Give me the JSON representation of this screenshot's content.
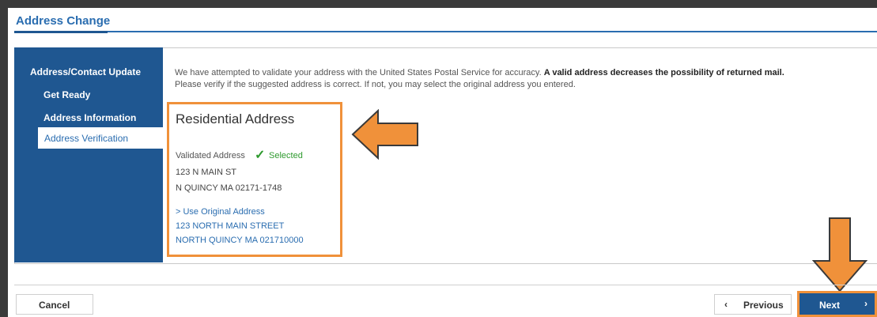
{
  "page": {
    "title": "Address Change"
  },
  "sidebar": {
    "heading": "Address/Contact Update",
    "items": [
      {
        "label": "Get Ready"
      },
      {
        "label": "Address Information"
      },
      {
        "label": "Address Verification",
        "active": true
      }
    ]
  },
  "intro": {
    "text": "We have attempted to validate your address with the United States Postal Service for accuracy.",
    "bold_text": "A valid address decreases the possibility of returned mail.",
    "line2": "Please verify if the suggested address is correct.  If not, you may select the original address you entered."
  },
  "address": {
    "title": "Residential Address",
    "validated_label": "Validated Address",
    "selected_label": "Selected",
    "validated_lines": [
      "123 N MAIN ST",
      "N QUINCY MA 02171-1748"
    ],
    "original_link": "> Use Original Address",
    "original_lines": [
      "123 NORTH MAIN STREET",
      "NORTH QUINCY MA 021710000"
    ]
  },
  "footer": {
    "cancel": "Cancel",
    "previous": "Previous",
    "next": "Next"
  },
  "icons": {
    "check": "check-icon",
    "chevron_left": "chevron-left-icon",
    "chevron_right": "chevron-right-icon",
    "annotation_arrow": "arrow-icon"
  },
  "colors": {
    "brand_blue": "#1f5791",
    "link_blue": "#2a6db0",
    "highlight_orange": "#f0913a",
    "success_green": "#2e9a2e"
  }
}
